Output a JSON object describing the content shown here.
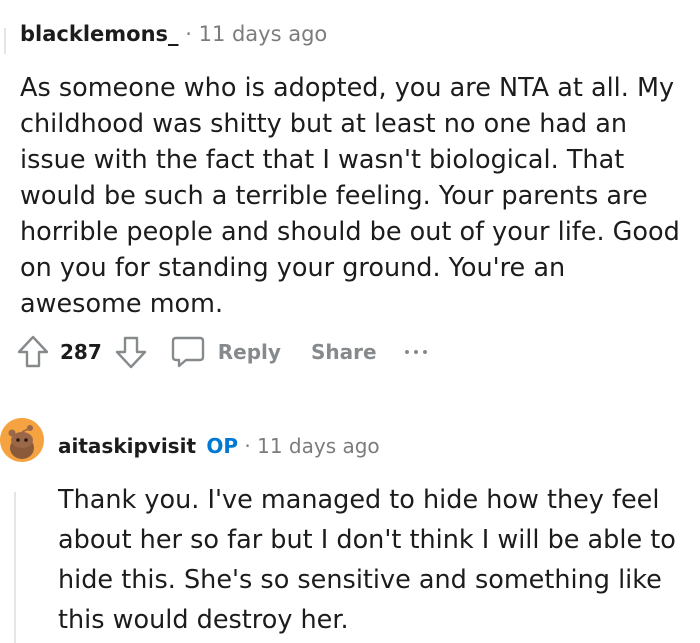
{
  "comment1": {
    "username": "blacklemons_",
    "separator": "·",
    "timestamp": "11 days ago",
    "body": "As someone who is adopted, you are NTA at all. My childhood was shitty but at least no one had an issue with the fact that I wasn't biological. That would be such a terrible feeling. Your parents are horrible people and should be out of your life. Good on you for standing your ground. You're an awesome mom.",
    "actions": {
      "upvote_icon": "arrow-up-icon",
      "vote_count": "287",
      "downvote_icon": "arrow-down-icon",
      "reply_icon": "speech-bubble-icon",
      "reply_label": "Reply",
      "share_label": "Share",
      "more_icon": "ellipsis-icon"
    }
  },
  "comment2": {
    "avatar_icon": "snoo-avatar-icon",
    "username": "aitaskipvisit",
    "op_badge": "OP",
    "separator": "·",
    "timestamp": "11 days ago",
    "body": "Thank you. I've managed to hide how they feel about her so far but I don't think I will be able to hide this. She's so sensitive and something like this would destroy her."
  },
  "colors": {
    "text": "#1c1c1c",
    "muted": "#7c7c7c",
    "action": "#878a8c",
    "op": "#0079d3",
    "avatar_bg": "#f4a340",
    "thread_line": "#e5e5e5"
  }
}
